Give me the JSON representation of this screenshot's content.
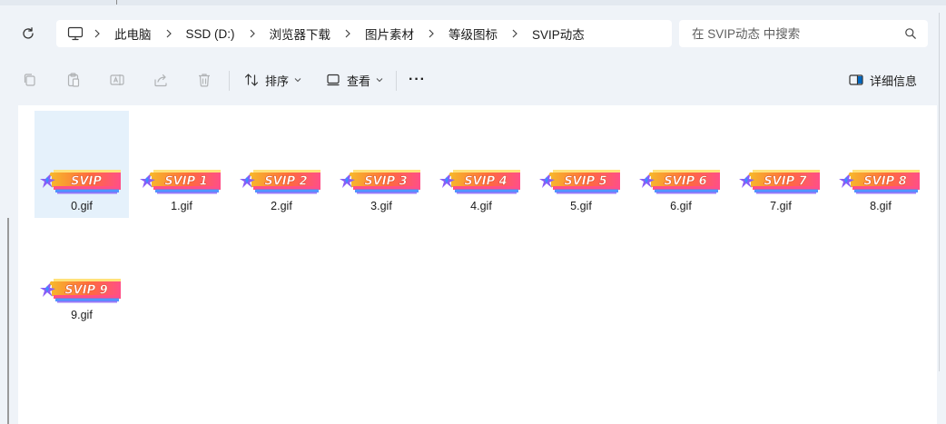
{
  "breadcrumb": {
    "items": [
      "此电脑",
      "SSD (D:)",
      "浏览器下载",
      "图片素材",
      "等级图标",
      "SVIP动态"
    ]
  },
  "search": {
    "placeholder": "在 SVIP动态 中搜索"
  },
  "toolbar": {
    "sort_label": "排序",
    "view_label": "查看",
    "more_label": "···",
    "details_label": "详细信息"
  },
  "files": [
    {
      "name": "0.gif",
      "badge": "SVIP",
      "selected": true
    },
    {
      "name": "1.gif",
      "badge": "SVIP 1"
    },
    {
      "name": "2.gif",
      "badge": "SVIP 2"
    },
    {
      "name": "3.gif",
      "badge": "SVIP 3"
    },
    {
      "name": "4.gif",
      "badge": "SVIP 4"
    },
    {
      "name": "5.gif",
      "badge": "SVIP 5"
    },
    {
      "name": "6.gif",
      "badge": "SVIP 6"
    },
    {
      "name": "7.gif",
      "badge": "SVIP 7"
    },
    {
      "name": "8.gif",
      "badge": "SVIP 8"
    },
    {
      "name": "9.gif",
      "badge": "SVIP 9"
    }
  ],
  "colors": {
    "accent": "#0067c0",
    "selection": "#e5f1fb",
    "badge_gold": "#f7b52c",
    "badge_orange": "#ff6a3d",
    "badge_pink": "#ff4f87",
    "badge_purple": "#8a5cf6",
    "badge_blue": "#3e8bff"
  }
}
